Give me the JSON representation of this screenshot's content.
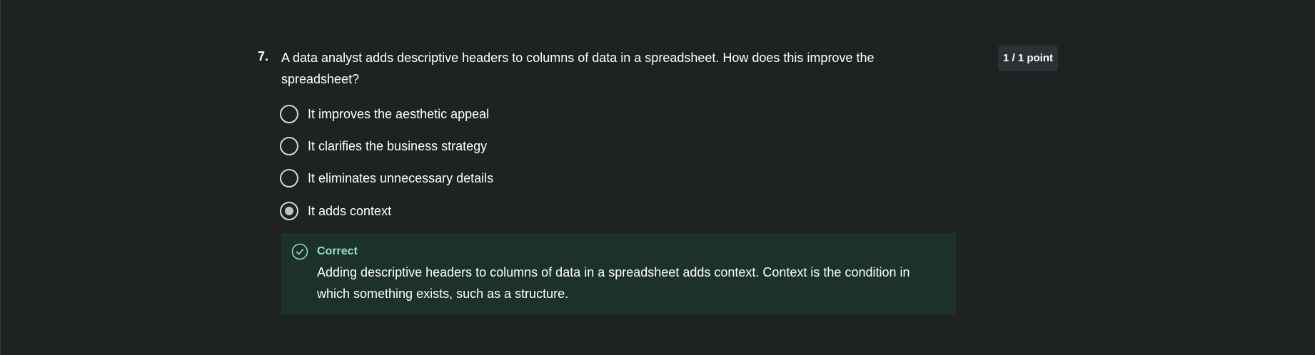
{
  "question": {
    "number": "7.",
    "text": "A data analyst adds descriptive headers to columns of data in a spreadsheet. How does this improve the spreadsheet?",
    "points": "1 / 1 point"
  },
  "options": [
    {
      "label": "It improves the aesthetic appeal",
      "selected": false
    },
    {
      "label": "It clarifies the business strategy",
      "selected": false
    },
    {
      "label": "It eliminates unnecessary details",
      "selected": false
    },
    {
      "label": "It adds context",
      "selected": true
    }
  ],
  "feedback": {
    "title": "Correct",
    "text": "Adding descriptive headers to columns of data in a spreadsheet adds context. Context is the condition in which something exists, such as a structure.",
    "icon": "check-circle-icon"
  },
  "colors": {
    "background": "#1f2223",
    "feedback_background": "#1b3129",
    "feedback_accent": "#8fe3c1",
    "badge_background": "#2e3133"
  }
}
